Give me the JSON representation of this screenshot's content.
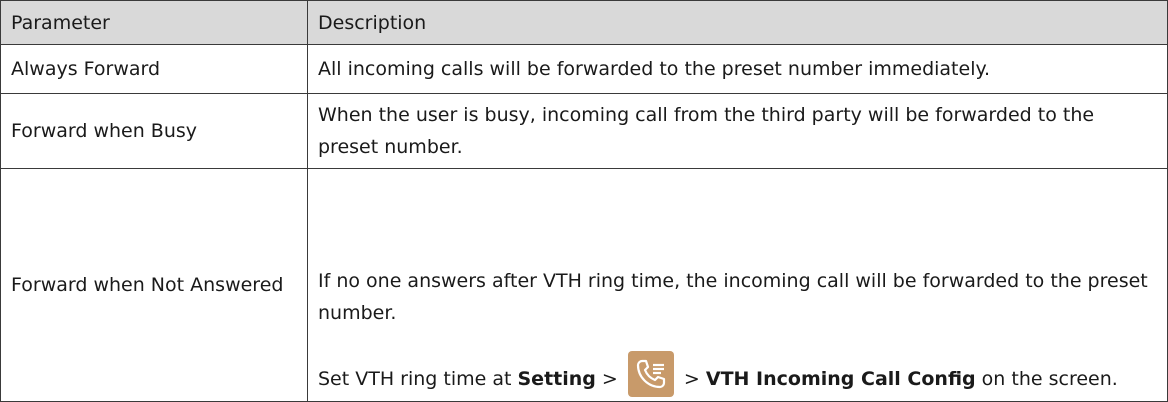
{
  "table": {
    "headers": [
      "Parameter",
      "Description"
    ],
    "rows": [
      {
        "parameter": "Always Forward",
        "description": "All incoming calls will be forwarded to the preset number immediately."
      },
      {
        "parameter": "Forward when Busy",
        "description": "When the user is busy, incoming call from the third party will be forwarded to the preset number."
      },
      {
        "parameter": "Forward when Not Answered",
        "description_p1": "If no one answers after VTH ring time, the incoming call will be forwarded to the preset number.",
        "desc_prefix": "Set VTH ring time at ",
        "setting_label": "Setting",
        "gt1": " > ",
        "icon": "phone-settings-icon",
        "gt2": " > ",
        "config_label": "VTH Incoming Call Config",
        "desc_suffix": " on the screen."
      }
    ]
  }
}
